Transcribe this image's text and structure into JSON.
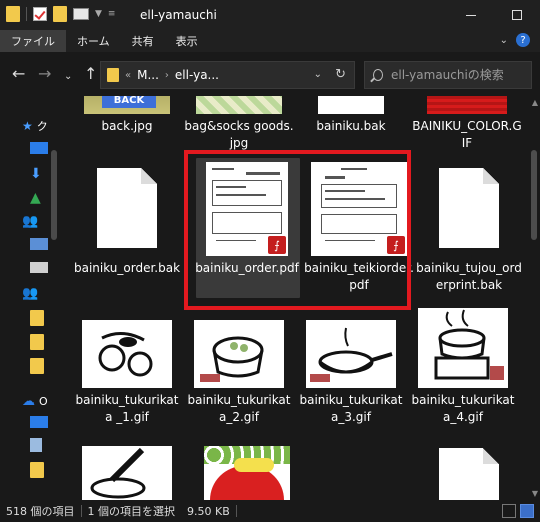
{
  "window": {
    "title": "ell-yamauchi"
  },
  "ribbon": {
    "tabs": [
      "ファイル",
      "ホーム",
      "共有",
      "表示"
    ],
    "help": "?"
  },
  "address": {
    "crumbs": [
      "M...",
      "ell-ya..."
    ],
    "separator_left": "«",
    "separator_mid": "›"
  },
  "search": {
    "placeholder": "ell-yamauchiの検索"
  },
  "sidebar": {
    "items": [
      {
        "icon": "star-icon",
        "label": "ク"
      },
      {
        "icon": "onedrive-icon",
        "label": "O"
      }
    ]
  },
  "files": [
    {
      "name": "back.jpg",
      "type": "image"
    },
    {
      "name": "bag&socks goods.jpg",
      "type": "image"
    },
    {
      "name": "bainiku.bak",
      "type": "image"
    },
    {
      "name": "BAINIKU_COLOR.GIF",
      "type": "image"
    },
    {
      "name": "bainiku_order.bak",
      "type": "blank"
    },
    {
      "name": "bainiku_order.pdf",
      "type": "pdf",
      "selected": true
    },
    {
      "name": "bainiku_teikiorder.pdf",
      "type": "pdf"
    },
    {
      "name": "bainiku_tujou_orderprint.bak",
      "type": "blank"
    },
    {
      "name": "bainiku_tukurikata _1.gif",
      "type": "gif"
    },
    {
      "name": "bainiku_tukurikata_2.gif",
      "type": "gif"
    },
    {
      "name": "bainiku_tukurikata_3.gif",
      "type": "gif"
    },
    {
      "name": "bainiku_tukurikata_4.gif",
      "type": "gif"
    }
  ],
  "status": {
    "count": "518 個の項目",
    "selection": "1 個の項目を選択",
    "size": "9.50 KB"
  },
  "colors": {
    "highlight": "#e3191f",
    "pdf_badge": "#c41e1e",
    "folder": "#f2c94c"
  }
}
